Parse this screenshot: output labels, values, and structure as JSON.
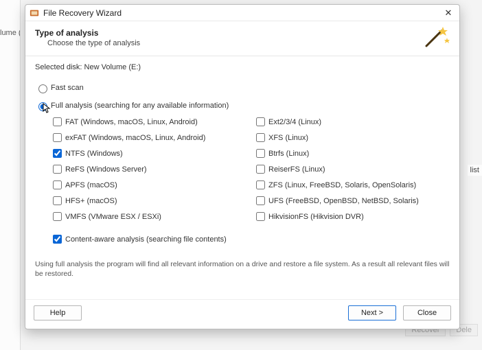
{
  "bg": {
    "sidebar_clip": "lume (E:",
    "list_label": "list",
    "recover_label": "Recover",
    "delete_label": "Dele"
  },
  "titlebar": {
    "title": "File Recovery Wizard"
  },
  "header": {
    "title": "Type of analysis",
    "subtitle": "Choose the type of analysis"
  },
  "selected_disk": {
    "label": "Selected disk:",
    "value": "New Volume (E:)"
  },
  "scan": {
    "fast_label": "Fast scan",
    "full_label": "Full analysis (searching for any available information)",
    "selected": "full"
  },
  "filesystems": {
    "left": [
      {
        "label": "FAT (Windows, macOS, Linux, Android)",
        "checked": false
      },
      {
        "label": "exFAT (Windows, macOS, Linux, Android)",
        "checked": false
      },
      {
        "label": "NTFS (Windows)",
        "checked": true
      },
      {
        "label": "ReFS (Windows Server)",
        "checked": false
      },
      {
        "label": "APFS (macOS)",
        "checked": false
      },
      {
        "label": "HFS+ (macOS)",
        "checked": false
      },
      {
        "label": "VMFS (VMware ESX / ESXi)",
        "checked": false
      }
    ],
    "right": [
      {
        "label": "Ext2/3/4 (Linux)",
        "checked": false
      },
      {
        "label": "XFS (Linux)",
        "checked": false
      },
      {
        "label": "Btrfs (Linux)",
        "checked": false
      },
      {
        "label": "ReiserFS (Linux)",
        "checked": false
      },
      {
        "label": "ZFS (Linux, FreeBSD, Solaris, OpenSolaris)",
        "checked": false
      },
      {
        "label": "UFS (FreeBSD, OpenBSD, NetBSD, Solaris)",
        "checked": false
      },
      {
        "label": "HikvisionFS (Hikvision DVR)",
        "checked": false
      }
    ]
  },
  "content_aware": {
    "label": "Content-aware analysis (searching file contents)",
    "checked": true
  },
  "hint": "Using full analysis the program will find all relevant information on a drive and restore a file system. As a result all relevant files will be restored.",
  "buttons": {
    "help": "Help",
    "next": "Next >",
    "close": "Close"
  }
}
